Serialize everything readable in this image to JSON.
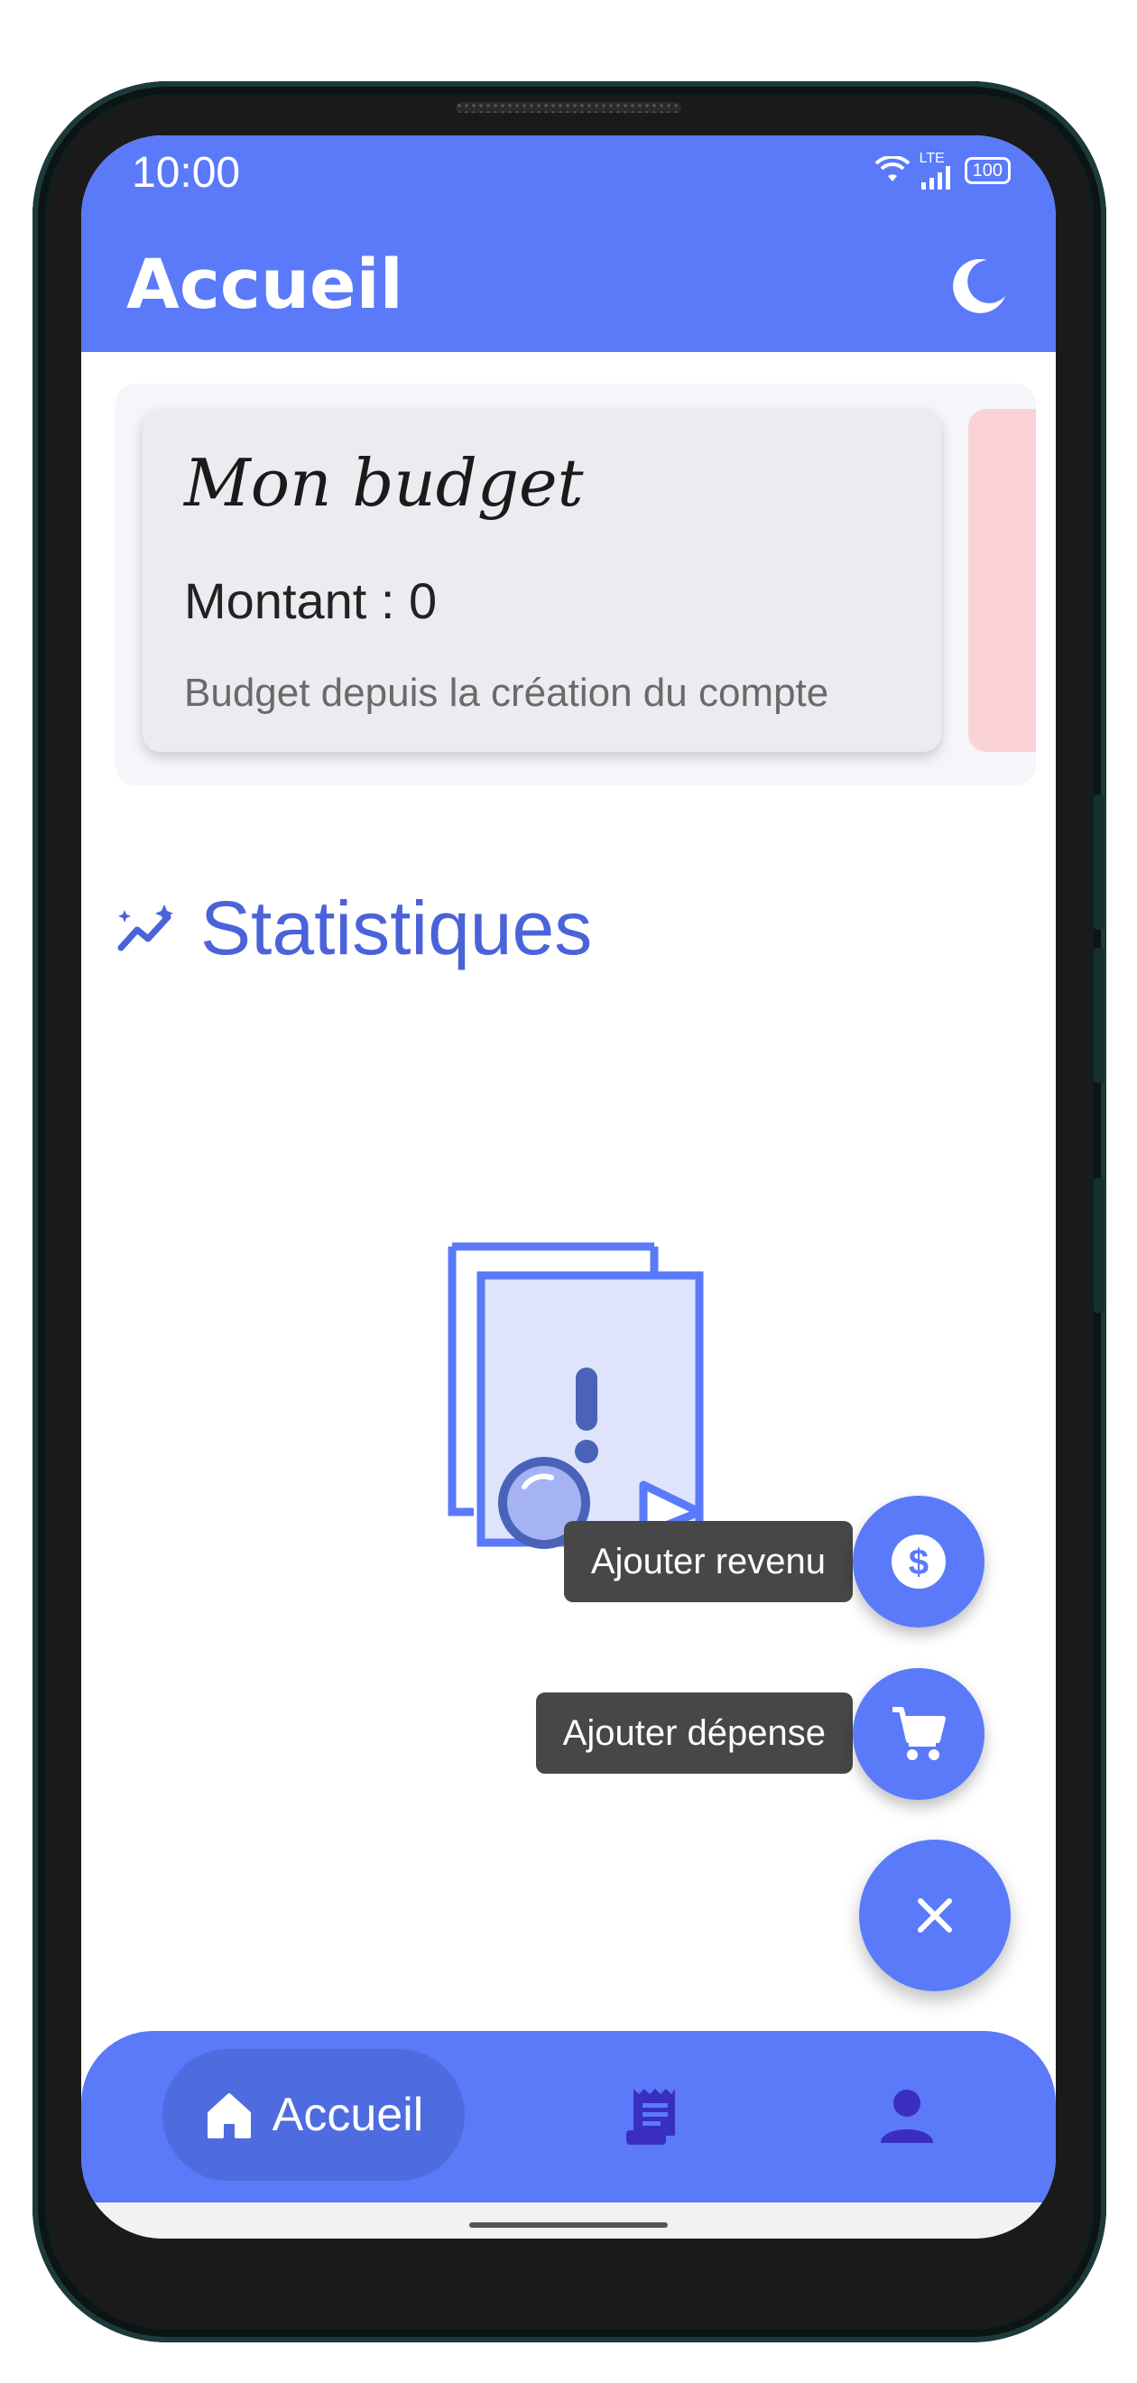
{
  "status_bar": {
    "time": "10:00",
    "network": "LTE",
    "battery": "100"
  },
  "app_bar": {
    "title": "Accueil",
    "theme_icon": "moon-icon"
  },
  "budget_card": {
    "title": "Mon budget",
    "amount": "Montant : 0",
    "subtitle": "Budget depuis la création du compte"
  },
  "statistics": {
    "heading": "Statistiques",
    "icon": "sparkle-chart-icon",
    "empty_icon": "no-document-icon"
  },
  "speed_dial": {
    "add_revenue_label": "Ajouter revenu",
    "add_expense_label": "Ajouter dépense",
    "revenue_icon": "dollar-icon",
    "expense_icon": "cart-icon",
    "close_icon": "close-icon"
  },
  "bottom_nav": {
    "items": [
      {
        "label": "Accueil",
        "icon": "home-icon",
        "active": true
      },
      {
        "label": "",
        "icon": "receipt-icon",
        "active": false
      },
      {
        "label": "",
        "icon": "person-icon",
        "active": false
      }
    ]
  },
  "colors": {
    "primary": "#5a7afa",
    "accent_text": "#4a63d9",
    "nav_active": "#4e6be0",
    "icon_dark": "#3a2ec0",
    "tooltip": "#474747",
    "next_card": "#fbd3d6"
  }
}
